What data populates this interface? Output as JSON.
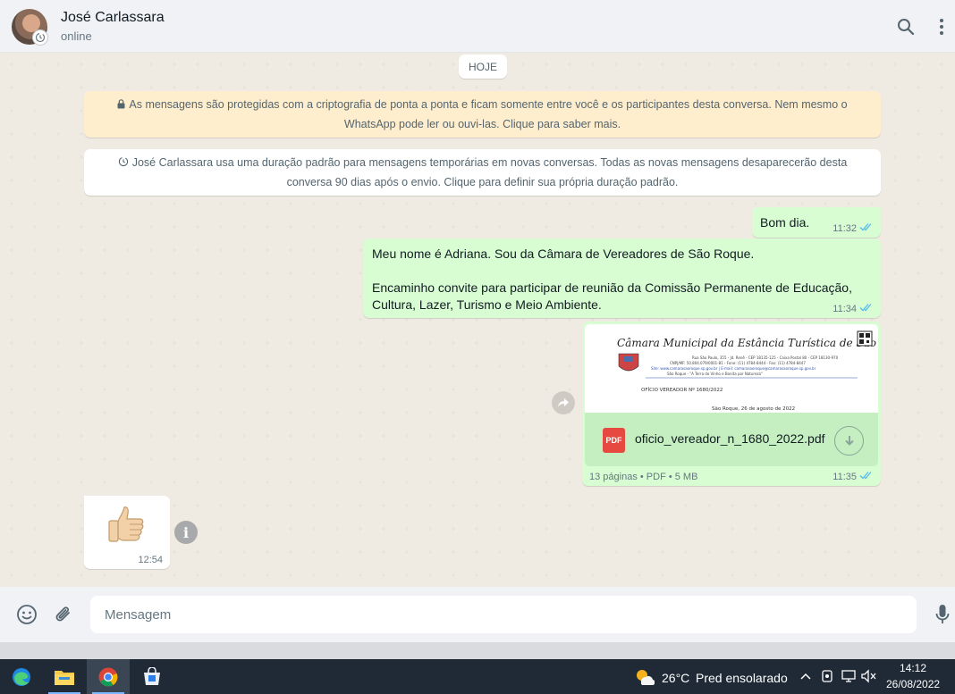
{
  "contact": {
    "name": "José Carlassara",
    "status": "online"
  },
  "chat": {
    "date_chip": "HOJE",
    "encryption_notice": "As mensagens são protegidas com a criptografia de ponta a ponta e ficam somente entre você e os participantes desta conversa. Nem mesmo o WhatsApp pode ler ou ouvi-las. Clique para saber mais.",
    "disappearing_notice": "José Carlassara usa uma duração padrão para mensagens temporárias em novas conversas. Todas as novas mensagens desaparecerão desta conversa 90 dias após o envio. Clique para definir sua própria duração padrão.",
    "messages": [
      {
        "direction": "out",
        "text": "Bom dia.",
        "time": "11:32",
        "read": true
      },
      {
        "direction": "out",
        "paragraphs": [
          "Meu nome é Adriana. Sou da Câmara de Vereadores de São Roque.",
          "Encaminho convite para participar de reunião da Comissão Permanente de Educação, Cultura, Lazer, Turismo e Meio Ambiente."
        ],
        "time": "11:34",
        "read": true
      },
      {
        "direction": "out",
        "type": "document",
        "preview": {
          "header": "Câmara Municipal da Estância Turística de São Roque",
          "address_lines": [
            "Rua São Paulo, 355 - Jd. Renê - CEP 18135-125 - Caixa Postal 80 - CEP 18130-970",
            "CNPJ/MF: 50.804.079/0001-81 - Fone: (11) 4784-8444 - Fax: (11) 4784-8447",
            "Site: www.camarasaoroque.sp.gov.br | E-mail: camarasaoroque@camarasaoroque.sp.gov.br",
            "São Roque - \"A Terra do Vinho e Bonita por Natureza\""
          ],
          "reference": "OFÍCIO VEREADOR Nº 1680/2022",
          "date_line": "São Roque, 26 de agosto de 2022"
        },
        "file_badge": "PDF",
        "filename": "oficio_vereador_n_1680_2022.pdf",
        "info": "13 páginas • PDF • 5 MB",
        "time": "11:35",
        "read": true
      },
      {
        "direction": "in",
        "type": "emoji",
        "emoji": "👍🏻",
        "time": "12:54"
      }
    ]
  },
  "composer": {
    "placeholder": "Mensagem"
  },
  "taskbar": {
    "apps": [
      "edge",
      "file-explorer",
      "chrome",
      "store"
    ],
    "weather_temp": "26°C",
    "weather_desc": "Pred ensolarado",
    "time": "14:12",
    "date": "26/08/2022"
  },
  "colors": {
    "outgoing_bubble": "#d9fdd3",
    "notice_yellow": "#ffeecd",
    "read_ticks": "#53bdeb",
    "pdf_red": "#e5493f"
  }
}
